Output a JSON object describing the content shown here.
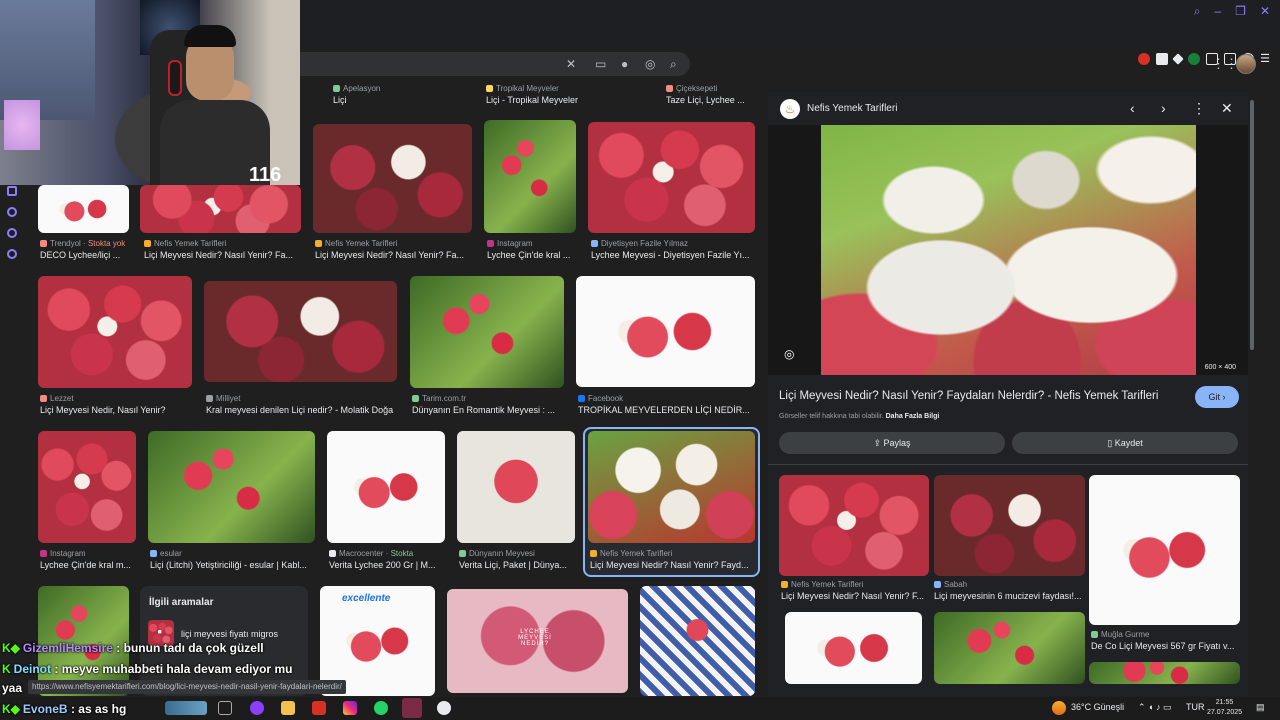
{
  "browser": {
    "search_placeholder": "",
    "extensions": [
      "#d93025",
      "#e8eaed",
      "#e8eaed",
      "#188038",
      "#e8eaed",
      "#e8eaed",
      "#e8eaed"
    ]
  },
  "top_sources": [
    {
      "site": "Apelasyon",
      "title": "Liçi"
    },
    {
      "site": "Tropikal Meyveler",
      "title": "Liçi - Tropikal Meyveler"
    },
    {
      "site": "Çiçeksepeti",
      "title": "Taze Liçi, Lychee ..."
    }
  ],
  "row1": [
    {
      "site": "Trendyol",
      "stock": "Stokta yok",
      "title": "DECO Lychee/liçi ..."
    },
    {
      "site": "Nefis Yemek Tarifleri",
      "title": "Liçi Meyvesi Nedir? Nasıl Yenir? Fa..."
    },
    {
      "site": "Nefis Yemek Tarifleri",
      "title": "Liçi Meyvesi Nedir? Nasıl Yenir? Fa..."
    },
    {
      "site": "Instagram",
      "title": "Lychee Çin'de kral ..."
    },
    {
      "site": "Diyetisyen Fazile Yılmaz",
      "title": "Lychee Meyvesi - Diyetisyen Fazile Yı..."
    }
  ],
  "row2": [
    {
      "site": "Lezzet",
      "title": "Liçi Meyvesi Nedir, Nasıl Yenir?"
    },
    {
      "site": "Milliyet",
      "title": "Kral meyvesi denilen Liçi nedir? - Molatik Doğa"
    },
    {
      "site": "Tarim.com.tr",
      "title": "Dünyanın En Romantik Meyvesi : ..."
    },
    {
      "site": "Facebook",
      "title": "TROPİKAL MEYVELERDEN LİÇİ NEDİR..."
    }
  ],
  "row3": [
    {
      "site": "Instagram",
      "title": "Lychee Çin'de kral m..."
    },
    {
      "site": "esular",
      "title": "Liçi (Litchi) Yetiştiriciliği - esular | Kabl..."
    },
    {
      "site": "Macrocenter",
      "stock": "Stokta",
      "title": "Verita Lychee 200 Gr | M..."
    },
    {
      "site": "Dünyanın Meyvesi",
      "title": "Verita Liçi, Paket | Dünya..."
    },
    {
      "site": "Nefis Yemek Tarifleri",
      "title": "Liçi Meyvesi Nedir? Nasıl Yenir? Fayd..."
    }
  ],
  "related": {
    "heading": "İlgili aramalar",
    "item": "liçi meyvesi fiyatı migros"
  },
  "row4_banner": {
    "brand": "excellente",
    "text": "LYCHEE MEYVESİ NEDİR?"
  },
  "panel": {
    "site": "Nefis Yemek Tarifleri",
    "dims": "600 × 400",
    "title": "Liçi Meyvesi Nedir? Nasıl Yenir? Faydaları Nelerdir? - Nefis Yemek Tarifleri",
    "go_label": "Git",
    "copyright_prefix": "Görseller telif hakkına tabi olabilir.",
    "copyright_link": "Daha Fazla Bilgi",
    "share_label": "Paylaş",
    "save_label": "Kaydet",
    "related": [
      {
        "site": "Nefis Yemek Tarifleri",
        "title": "Liçi Meyvesi Nedir? Nasıl Yenir? F..."
      },
      {
        "site": "Sabah",
        "title": "Liçi meyvesinin 6 mucizevi faydası!..."
      },
      {
        "site": "Muğla Gurme",
        "title": "De Co Liçi Meyvesi 567 gr Fiyatı v..."
      }
    ]
  },
  "stream": {
    "counter": "116"
  },
  "chat": [
    {
      "user": "GizemliHemsire",
      "message": ": bunun tadı da çok güzell"
    },
    {
      "user": "Deinot",
      "message": ": meyve muhabbeti hala devam ediyor mu"
    },
    {
      "user": "",
      "message": "yaa"
    },
    {
      "user": "EvoneB",
      "message": ": as as hg"
    }
  ],
  "status_url": "https://www.nefisyemektarifleri.com/blog/lici-meyvesi-nedir-nasil-yenir-faydalari-nelerdir/",
  "taskbar": {
    "weather": "36°C  Güneşli",
    "lang": "TUR",
    "time": "21:55",
    "date": "27.07.2025"
  }
}
